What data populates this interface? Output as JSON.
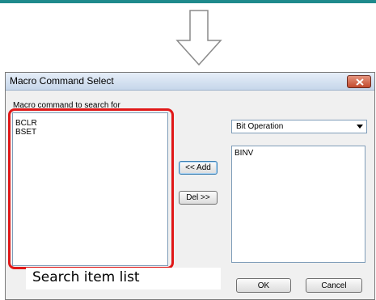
{
  "dialog": {
    "title": "Macro Command Select",
    "search_label": "Macro command to search for",
    "left_list": [
      "BCLR",
      "BSET"
    ],
    "category_select": "Bit Operation",
    "right_list": [
      "BINV"
    ],
    "add_button": "<< Add",
    "del_button": "Del >>",
    "ok_button": "OK",
    "cancel_button": "Cancel"
  },
  "annotation": {
    "caption": "Search item list",
    "highlight_color": "#e01818"
  },
  "icons": {
    "arrow": "down-arrow-icon",
    "close": "close-icon"
  }
}
